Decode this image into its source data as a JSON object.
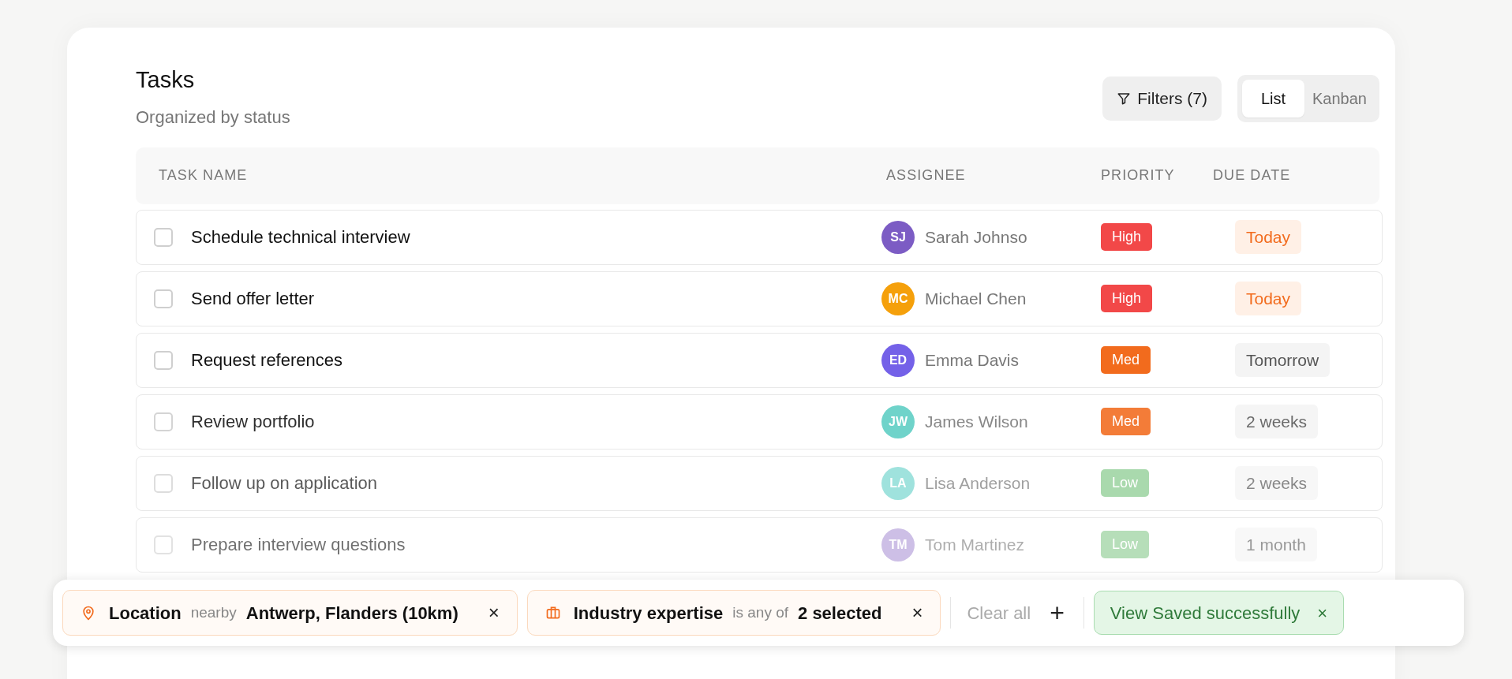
{
  "header": {
    "title": "Tasks",
    "subtitle": "Organized by status"
  },
  "filters_button": {
    "label": "Filters (7)"
  },
  "view_toggle": [
    {
      "label": "List",
      "selected": true
    },
    {
      "label": "Kanban",
      "selected": false
    }
  ],
  "table": {
    "columns": [
      "TASK NAME",
      "ASSIGNEE",
      "PRIORITY",
      "DUE DATE"
    ],
    "rows": [
      {
        "task": "Schedule technical interview",
        "checked": false,
        "avatar": {
          "initials": "SJ",
          "color": "#7c5cc4"
        },
        "assignee": "Sarah Johnso",
        "priority": {
          "label": "High",
          "kind": "high"
        },
        "due": {
          "label": "Today",
          "kind": "soon"
        }
      },
      {
        "task": "Send offer letter",
        "checked": false,
        "avatar": {
          "initials": "MC",
          "color": "#f5a00b"
        },
        "assignee": "Michael Chen",
        "priority": {
          "label": "High",
          "kind": "high"
        },
        "due": {
          "label": "Today",
          "kind": "soon"
        }
      },
      {
        "task": "Request references",
        "checked": false,
        "avatar": {
          "initials": "ED",
          "color": "#7461e8"
        },
        "assignee": "Emma Davis",
        "priority": {
          "label": "Med",
          "kind": "med"
        },
        "due": {
          "label": "Tomorrow",
          "kind": "later"
        }
      },
      {
        "task": "Review portfolio",
        "checked": false,
        "avatar": {
          "initials": "JW",
          "color": "#6fd3ca"
        },
        "assignee": "James Wilson",
        "priority": {
          "label": "Med",
          "kind": "med"
        },
        "due": {
          "label": "2 weeks",
          "kind": "later"
        }
      },
      {
        "task": "Follow up on application",
        "checked": false,
        "avatar": {
          "initials": "LA",
          "color": "#9fe2dd"
        },
        "assignee": "Lisa Anderson",
        "priority": {
          "label": "Low",
          "kind": "low"
        },
        "due": {
          "label": "2 weeks",
          "kind": "later"
        }
      },
      {
        "task": "Prepare interview questions",
        "checked": false,
        "avatar": {
          "initials": "TM",
          "color": "#cdbfe6"
        },
        "assignee": "Tom Martinez",
        "priority": {
          "label": "Low",
          "kind": "low"
        },
        "due": {
          "label": "1 month",
          "kind": "later"
        }
      }
    ]
  },
  "filter_bar": {
    "chips": [
      {
        "kind": "location",
        "label": "Location",
        "operator": "nearby",
        "value": "Antwerp, Flanders (10km)",
        "remove": "×"
      },
      {
        "kind": "industry",
        "label": "Industry expertise",
        "operator": "is any of",
        "value": "2 selected",
        "remove": "×"
      }
    ],
    "clear_all": "Clear all",
    "add": "+",
    "toast": {
      "message": "View Saved successfully",
      "close": "×"
    }
  }
}
